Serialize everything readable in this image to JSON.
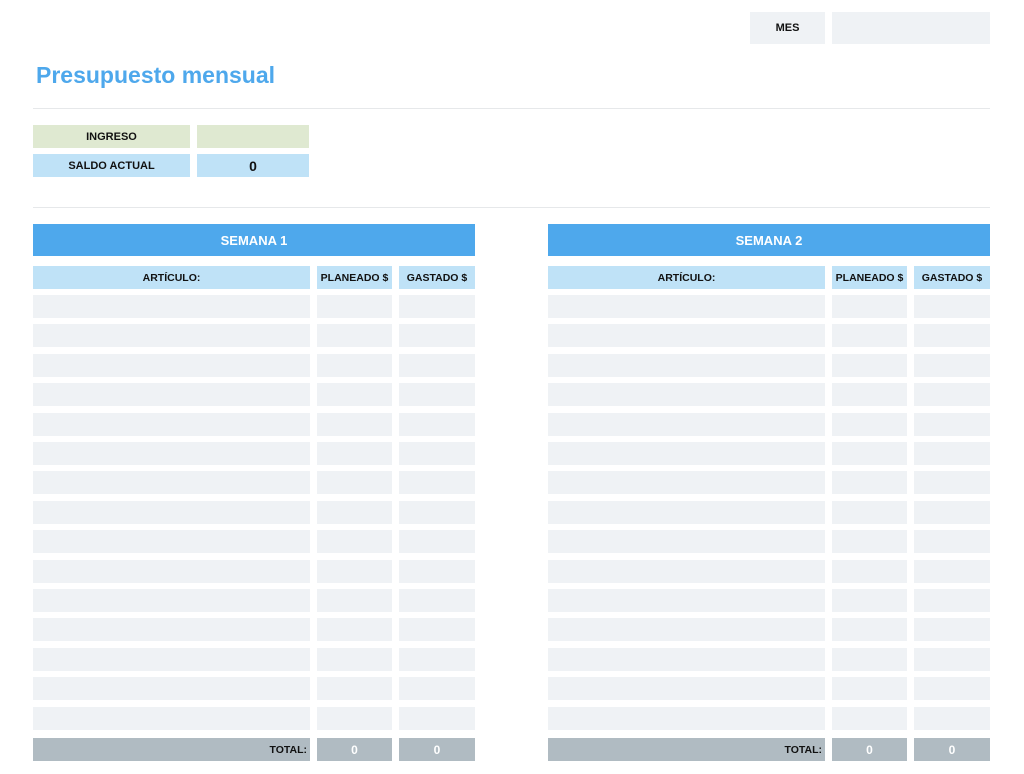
{
  "header": {
    "month_label": "MES",
    "month_value": "",
    "title": "Presupuesto mensual"
  },
  "summary": {
    "income_label": "INGRESO",
    "income_value": "",
    "balance_label": "SALDO ACTUAL",
    "balance_value": "0"
  },
  "weeks": [
    {
      "title": "SEMANA 1",
      "columns": [
        "ARTÍCULO:",
        "PLANEADO $",
        "GASTADO $"
      ],
      "total_label": "TOTAL:",
      "total_planned": "0",
      "total_spent": "0"
    },
    {
      "title": "SEMANA 2",
      "columns": [
        "ARTÍCULO:",
        "PLANEADO $",
        "GASTADO $"
      ],
      "total_label": "TOTAL:",
      "total_planned": "0",
      "total_spent": "0"
    }
  ],
  "colors": {
    "accent": "#4ea8ec",
    "header_light": "#bfe2f7",
    "income_green": "#dfe9d1",
    "input_gray": "#eff2f5",
    "total_gray": "#b0bbc2"
  }
}
